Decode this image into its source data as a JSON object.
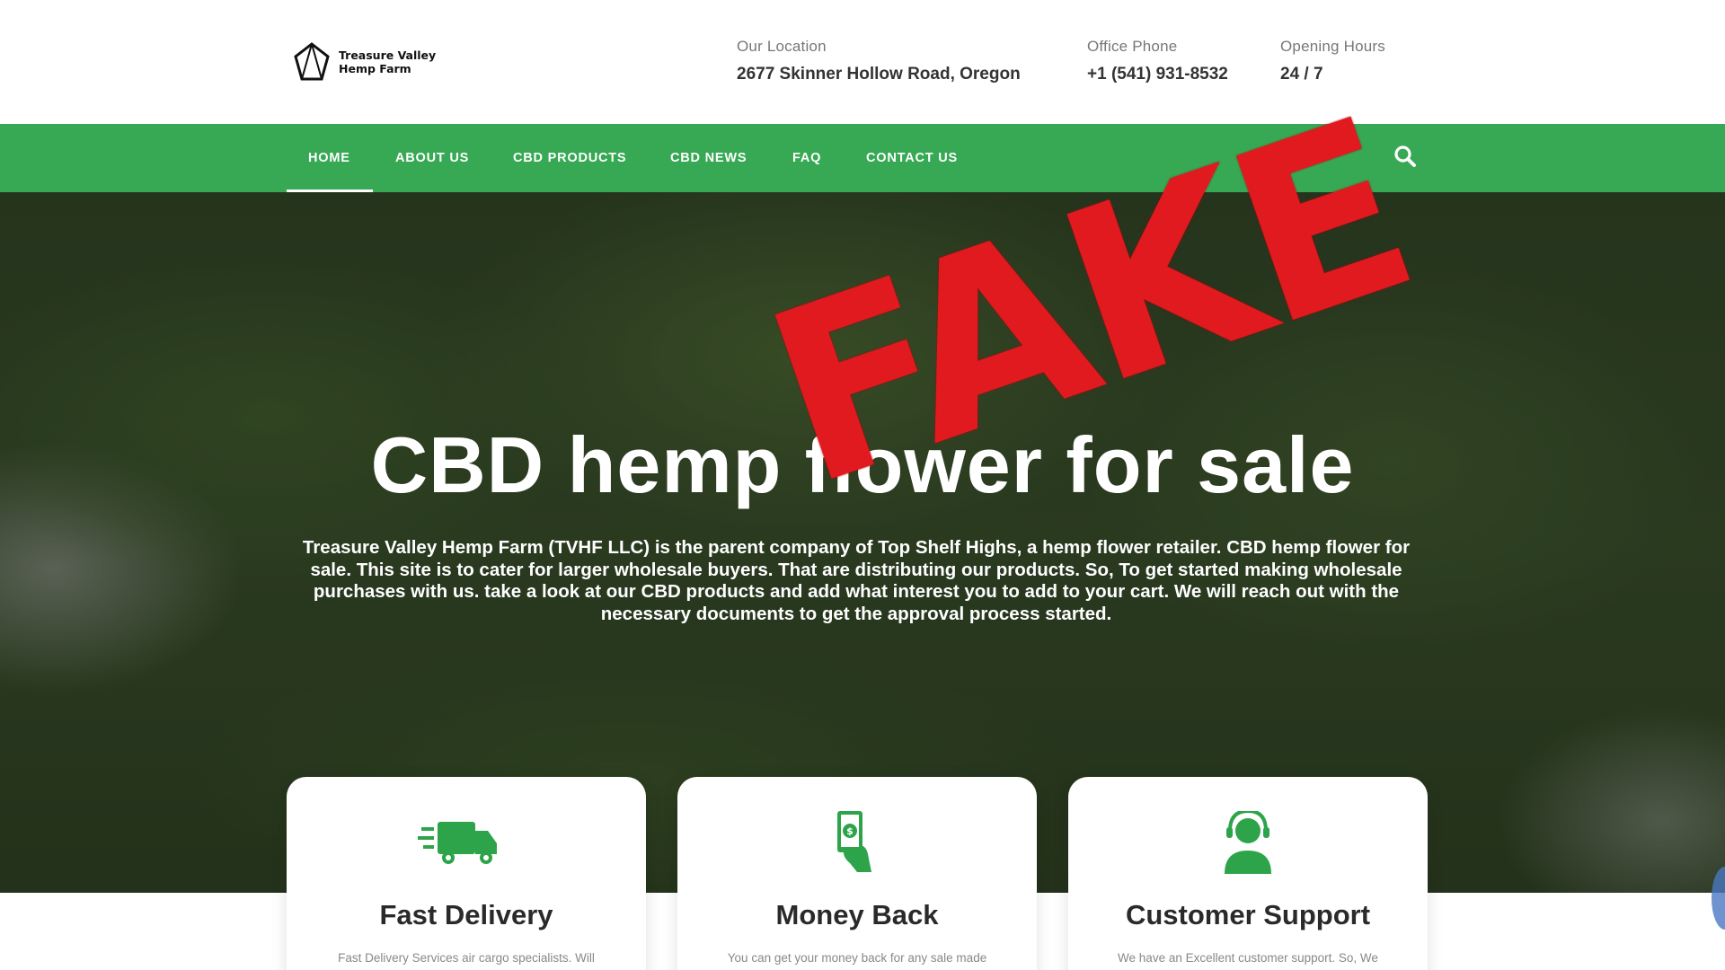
{
  "header": {
    "logo_text": "Treasure Valley Hemp Farm",
    "location_label": "Our Location",
    "location_value": "2677 Skinner Hollow Road, Oregon",
    "phone_label": "Office Phone",
    "phone_value": "+1 (541) 931-8532",
    "hours_label": "Opening Hours",
    "hours_value": "24 / 7"
  },
  "nav": {
    "items": [
      {
        "label": "HOME",
        "active": true
      },
      {
        "label": "ABOUT US"
      },
      {
        "label": "CBD PRODUCTS"
      },
      {
        "label": "CBD NEWS"
      },
      {
        "label": "FAQ"
      },
      {
        "label": "CONTACT US"
      }
    ],
    "search_icon": "search-icon"
  },
  "hero": {
    "title": "CBD hemp flower for sale",
    "text": "Treasure Valley Hemp Farm (TVHF LLC) is the parent company of Top Shelf Highs, a hemp flower retailer. CBD hemp flower for sale. This site is to cater for larger wholesale buyers. That are distributing our products. So, To get started making wholesale purchases with us. take a look at our CBD products and add what interest you to add to your cart. We will reach out with the necessary documents to get the approval process started."
  },
  "stamp": {
    "text": "FAKE",
    "color": "#e01a1f"
  },
  "features": [
    {
      "title": "Fast Delivery",
      "text": "Fast Delivery Services air cargo specialists. Will",
      "icon": "truck-icon"
    },
    {
      "title": "Money Back",
      "text": "You can get your money back for any sale made",
      "icon": "money-hand-icon"
    },
    {
      "title": "Customer Support",
      "text": "We have an Excellent customer support. So, We",
      "icon": "headset-icon"
    }
  ],
  "colors": {
    "brand_green": "#37a854",
    "icon_green": "#2ea44a"
  }
}
